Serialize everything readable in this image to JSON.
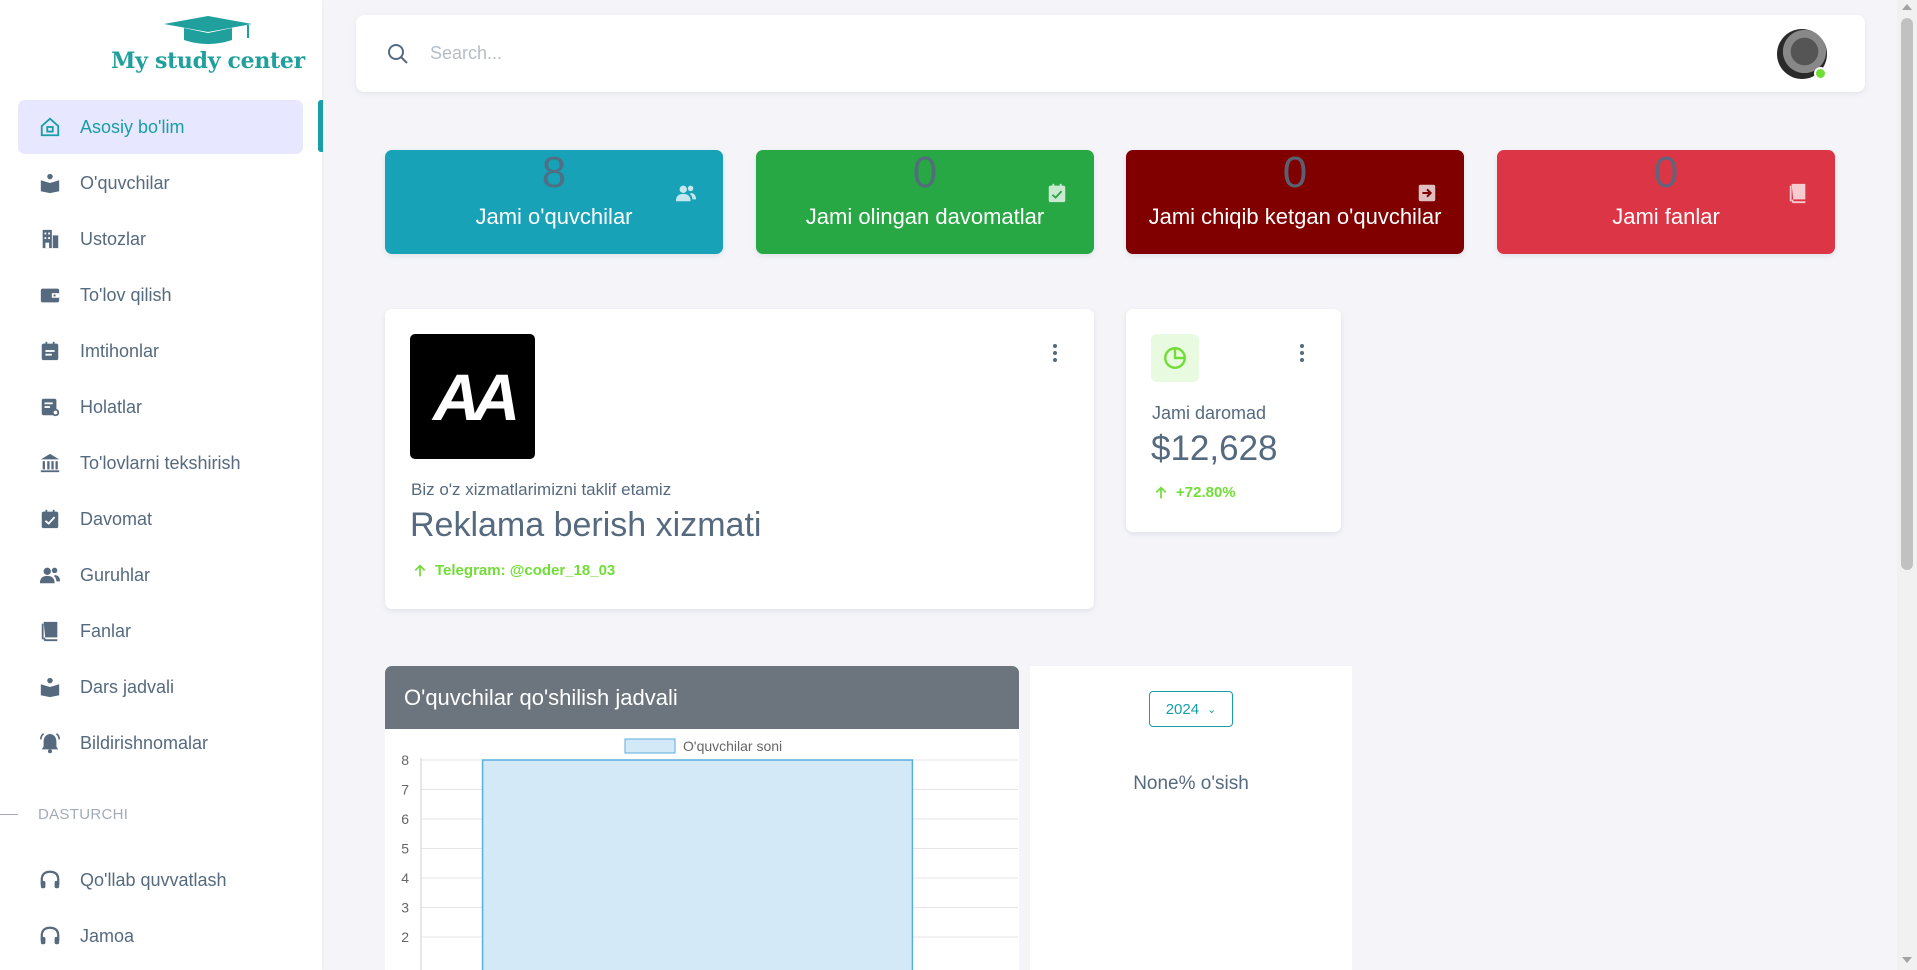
{
  "brand": {
    "name": "My study center"
  },
  "sidebar": {
    "items": [
      {
        "label": "Asosiy bo'lim",
        "icon": "home-icon"
      },
      {
        "label": "O'quvchilar",
        "icon": "reader-icon"
      },
      {
        "label": "Ustozlar",
        "icon": "building-icon"
      },
      {
        "label": "To'lov qilish",
        "icon": "wallet-icon"
      },
      {
        "label": "Imtihonlar",
        "icon": "calendar-list-icon"
      },
      {
        "label": "Holatlar",
        "icon": "report-icon"
      },
      {
        "label": "To'lovlarni tekshirish",
        "icon": "bank-icon"
      },
      {
        "label": "Davomat",
        "icon": "calendar-check-icon"
      },
      {
        "label": "Guruhlar",
        "icon": "users-icon"
      },
      {
        "label": "Fanlar",
        "icon": "book-icon"
      },
      {
        "label": "Dars jadvali",
        "icon": "reader-icon"
      },
      {
        "label": "Bildirishnomalar",
        "icon": "bell-icon"
      }
    ],
    "section_header": "DASTURCHI",
    "dev_items": [
      {
        "label": "Qo'llab quvvatlash",
        "icon": "headphones-icon"
      },
      {
        "label": "Jamoa",
        "icon": "headphones-icon"
      }
    ]
  },
  "search": {
    "placeholder": "Search..."
  },
  "stats": [
    {
      "value": "8",
      "label": "Jami o'quvchilar",
      "color": "#17a2b8",
      "icon": "users-icon"
    },
    {
      "value": "0",
      "label": "Jami olingan davomatlar",
      "color": "#28a745",
      "icon": "calendar-check-icon"
    },
    {
      "value": "0",
      "label": "Jami chiqib ketgan o'quvchilar",
      "color": "#800000",
      "icon": "exit-icon"
    },
    {
      "value": "0",
      "label": "Jami fanlar",
      "color": "#dc3545",
      "icon": "book-icon"
    }
  ],
  "promo": {
    "logo_text": "AA",
    "subtitle": "Biz o'z xizmatlarimizni taklif etamiz",
    "title": "Reklama berish xizmati",
    "telegram": "Telegram: @coder_18_03"
  },
  "income": {
    "label": "Jami daromad",
    "value": "$12,628",
    "change": "+72.80%"
  },
  "chart_section": {
    "title": "O'quvchilar qo'shilish jadvali"
  },
  "chart_data": {
    "type": "bar",
    "title": "",
    "categories": [
      ""
    ],
    "series": [
      {
        "name": "O'quvchilar soni",
        "values": [
          8
        ]
      }
    ],
    "ylim": [
      0,
      8
    ],
    "y_ticks": [
      2,
      3,
      4,
      5,
      6,
      7,
      8
    ],
    "grid": true,
    "legend": "top",
    "colors": {
      "fill": "#d4e9f7",
      "stroke": "#5aaedf"
    }
  },
  "growth": {
    "year": "2024",
    "text": "None% o'sish"
  },
  "colors": {
    "accent": "#179ea6",
    "success": "#71dd37"
  }
}
